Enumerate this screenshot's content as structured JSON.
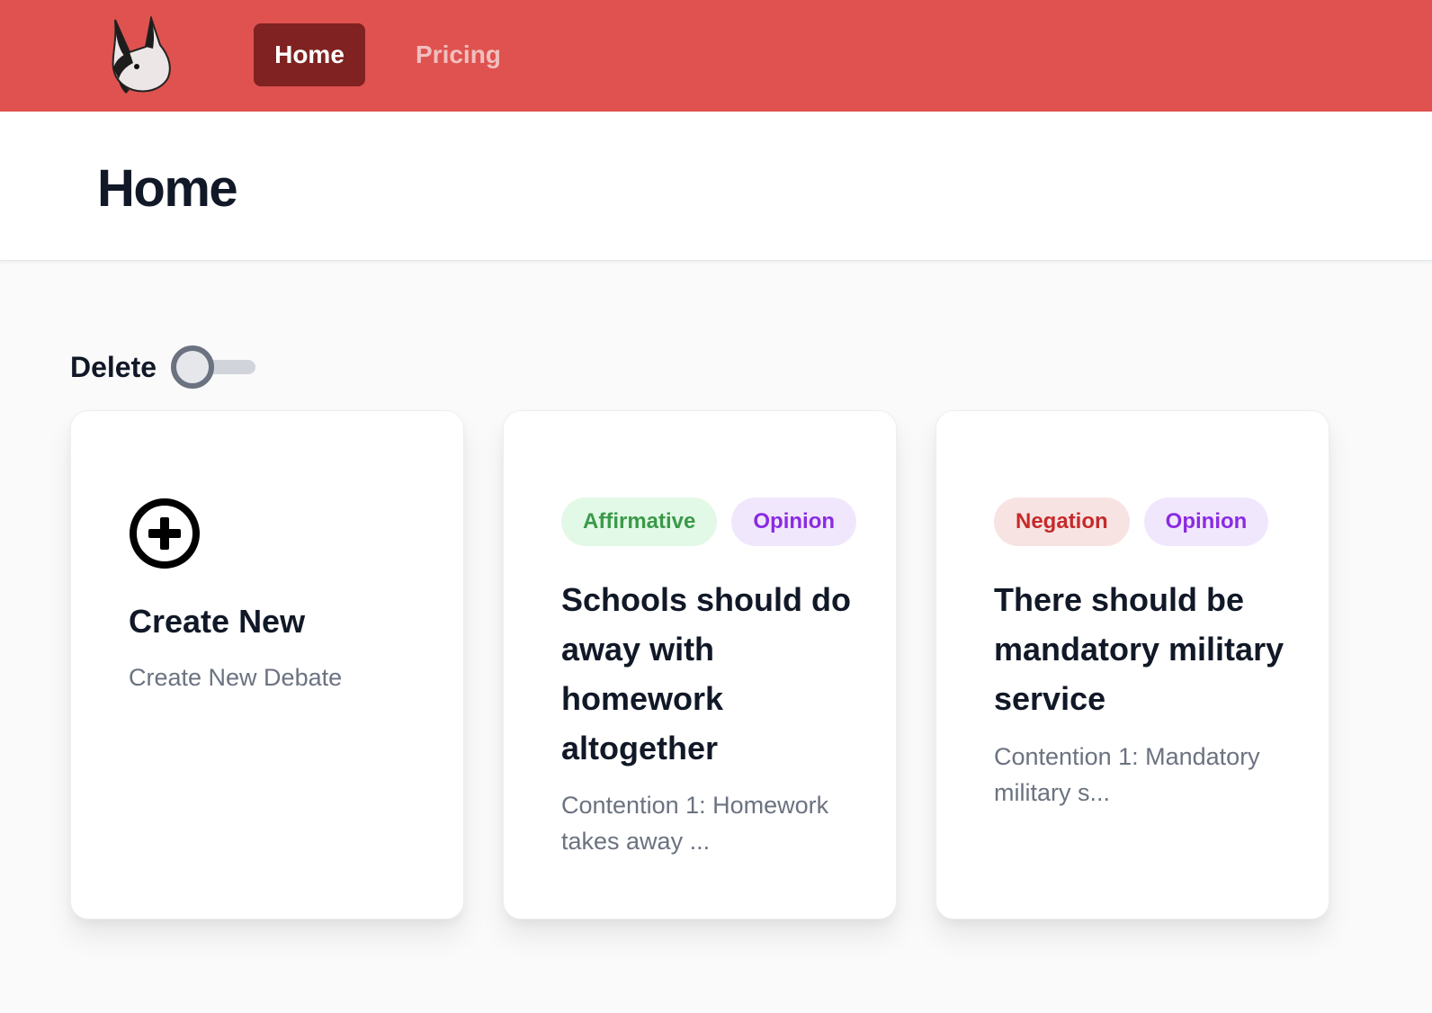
{
  "nav": {
    "items": [
      {
        "label": "Home",
        "active": true
      },
      {
        "label": "Pricing",
        "active": false
      }
    ],
    "colors": {
      "bar": "#df524f",
      "active": "#7f2221"
    }
  },
  "header": {
    "title": "Home"
  },
  "controls": {
    "delete_label": "Delete",
    "delete_enabled": false
  },
  "cards": [
    {
      "type": "create",
      "title": "Create New",
      "description": "Create New Debate",
      "icon": "plus-circle-icon"
    },
    {
      "type": "debate",
      "tags": [
        {
          "label": "Affirmative",
          "color": "#3a9a49"
        },
        {
          "label": "Opinion",
          "color": "#8a2be2"
        }
      ],
      "title": "Schools should do away with homework altogether",
      "description": "Contention 1: Homework takes away ..."
    },
    {
      "type": "debate",
      "tags": [
        {
          "label": "Negation",
          "color": "#c62a2a"
        },
        {
          "label": "Opinion",
          "color": "#8a2be2"
        }
      ],
      "title": "There should be mandatory military service",
      "description": "Contention 1: Mandatory military s..."
    }
  ]
}
